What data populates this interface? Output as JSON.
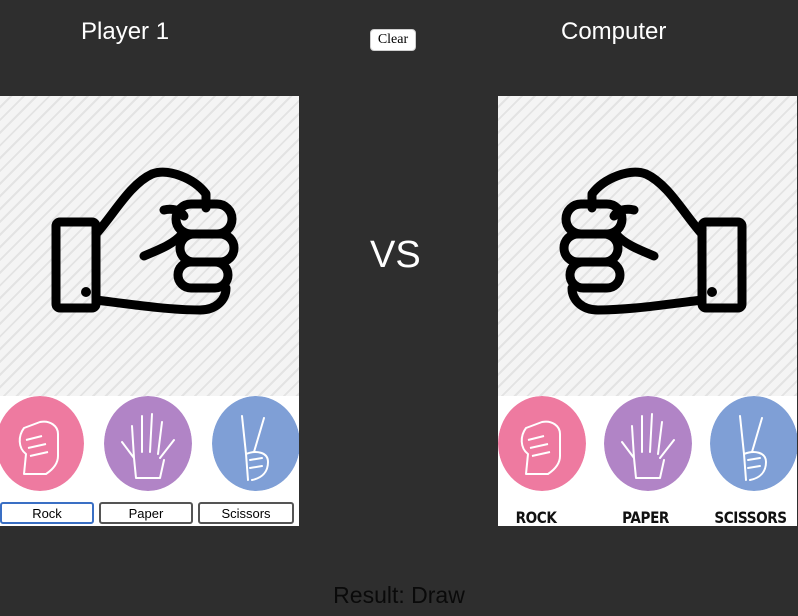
{
  "player": {
    "title": "Player 1"
  },
  "computer": {
    "title": "Computer"
  },
  "toolbar": {
    "clear_label": "Clear"
  },
  "vs_label": "VS",
  "player_choices": [
    {
      "label": "Rock",
      "icon": "rock-hand-icon",
      "color": "#ee7aa0",
      "active": true
    },
    {
      "label": "Paper",
      "icon": "paper-hand-icon",
      "color": "#b184c6",
      "active": false
    },
    {
      "label": "Scissors",
      "icon": "scissors-hand-icon",
      "color": "#7f9fd6",
      "active": false
    }
  ],
  "computer_choices": [
    {
      "label": "ROCK",
      "icon": "rock-hand-icon",
      "color": "#ee7aa0"
    },
    {
      "label": "PAPER",
      "icon": "paper-hand-icon",
      "color": "#b184c6"
    },
    {
      "label": "SCISSORS",
      "icon": "scissors-hand-icon",
      "color": "#7f9fd6"
    }
  ],
  "player_selection_icon": "fist-icon",
  "computer_selection_icon": "fist-icon",
  "result": {
    "text": "Result: Draw"
  }
}
